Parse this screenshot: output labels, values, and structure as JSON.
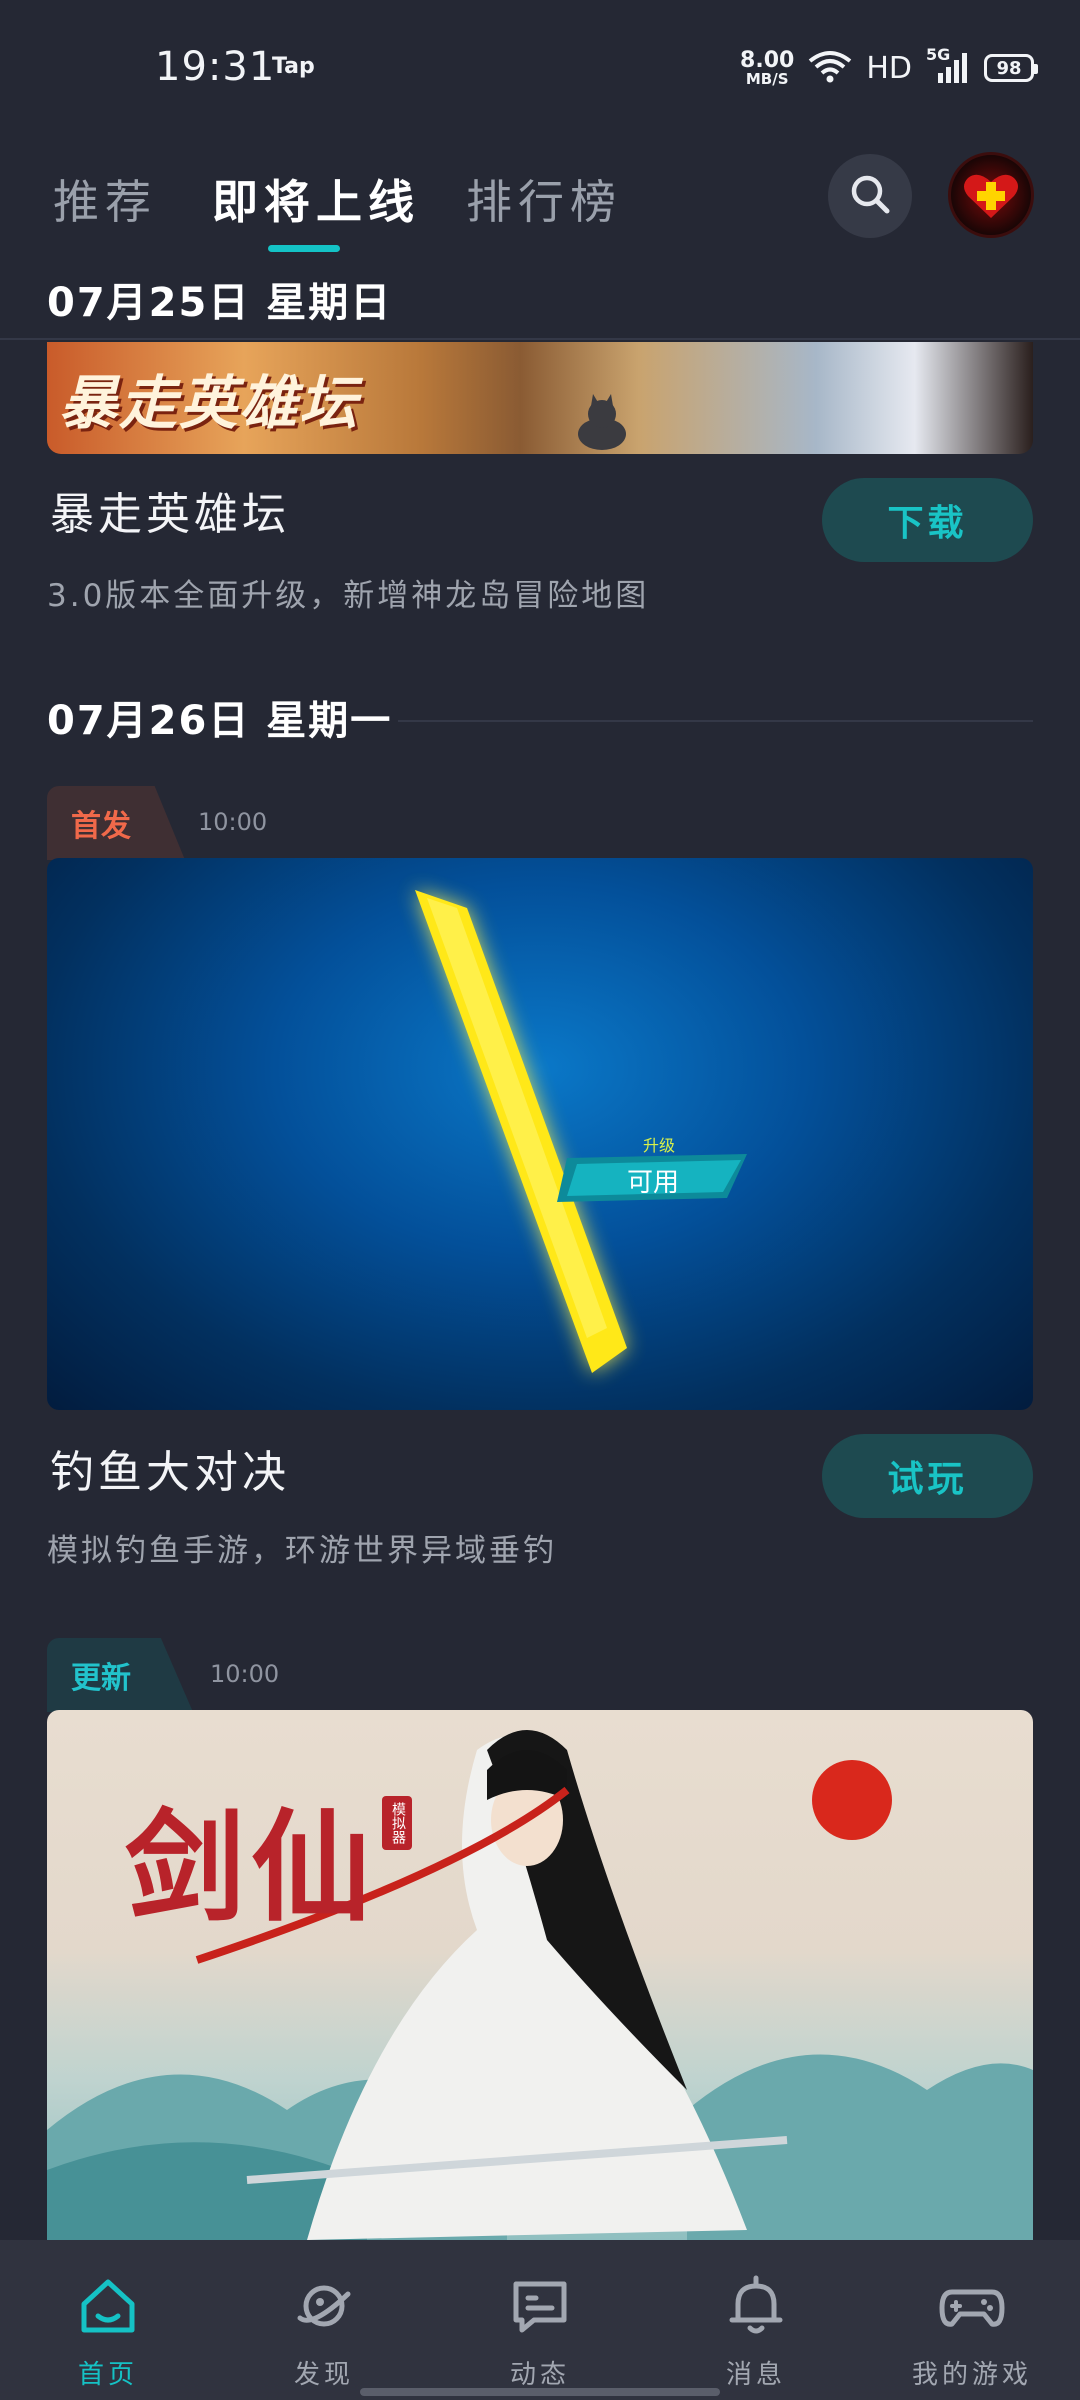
{
  "status_bar": {
    "time": "19:31",
    "app_label": "Tap",
    "net_speed_value": "8.00",
    "net_speed_unit": "MB/S",
    "hd": "HD",
    "signal": "5G",
    "battery": "98"
  },
  "top_tabs": [
    {
      "label": "推荐",
      "active": false
    },
    {
      "label": "即将上线",
      "active": true
    },
    {
      "label": "排行榜",
      "active": false
    }
  ],
  "icons": {
    "search": "search-icon",
    "avatar": "user-avatar"
  },
  "sections": [
    {
      "date": "07月25日 星期日",
      "games": [
        {
          "banner_text": "暴走英雄坛",
          "title": "暴走英雄坛",
          "description": "3.0版本全面升级，新增神龙岛冒险地图",
          "action": "下载"
        }
      ]
    },
    {
      "date": "07月26日 星期一",
      "games": [
        {
          "badge": "首发",
          "time": "10:00",
          "banner_upgrade": "升级",
          "banner_available": "可用",
          "title": "钓鱼大对决",
          "description": "模拟钓鱼手游，环游世界异域垂钓",
          "action": "试玩"
        },
        {
          "badge": "更新",
          "time": "10:00",
          "banner_logo": "剑仙",
          "banner_seal": "模拟器"
        }
      ]
    }
  ],
  "bottom_nav": [
    {
      "label": "首页",
      "icon": "home-icon",
      "active": true
    },
    {
      "label": "发现",
      "icon": "planet-icon",
      "active": false
    },
    {
      "label": "动态",
      "icon": "chat-icon",
      "active": false
    },
    {
      "label": "消息",
      "icon": "bell-icon",
      "active": false
    },
    {
      "label": "我的游戏",
      "icon": "gamepad-icon",
      "active": false
    }
  ],
  "colors": {
    "background": "#252834",
    "accent": "#15c2c5",
    "badge_first": "#f0694a",
    "button_bg": "#1e4a50"
  }
}
